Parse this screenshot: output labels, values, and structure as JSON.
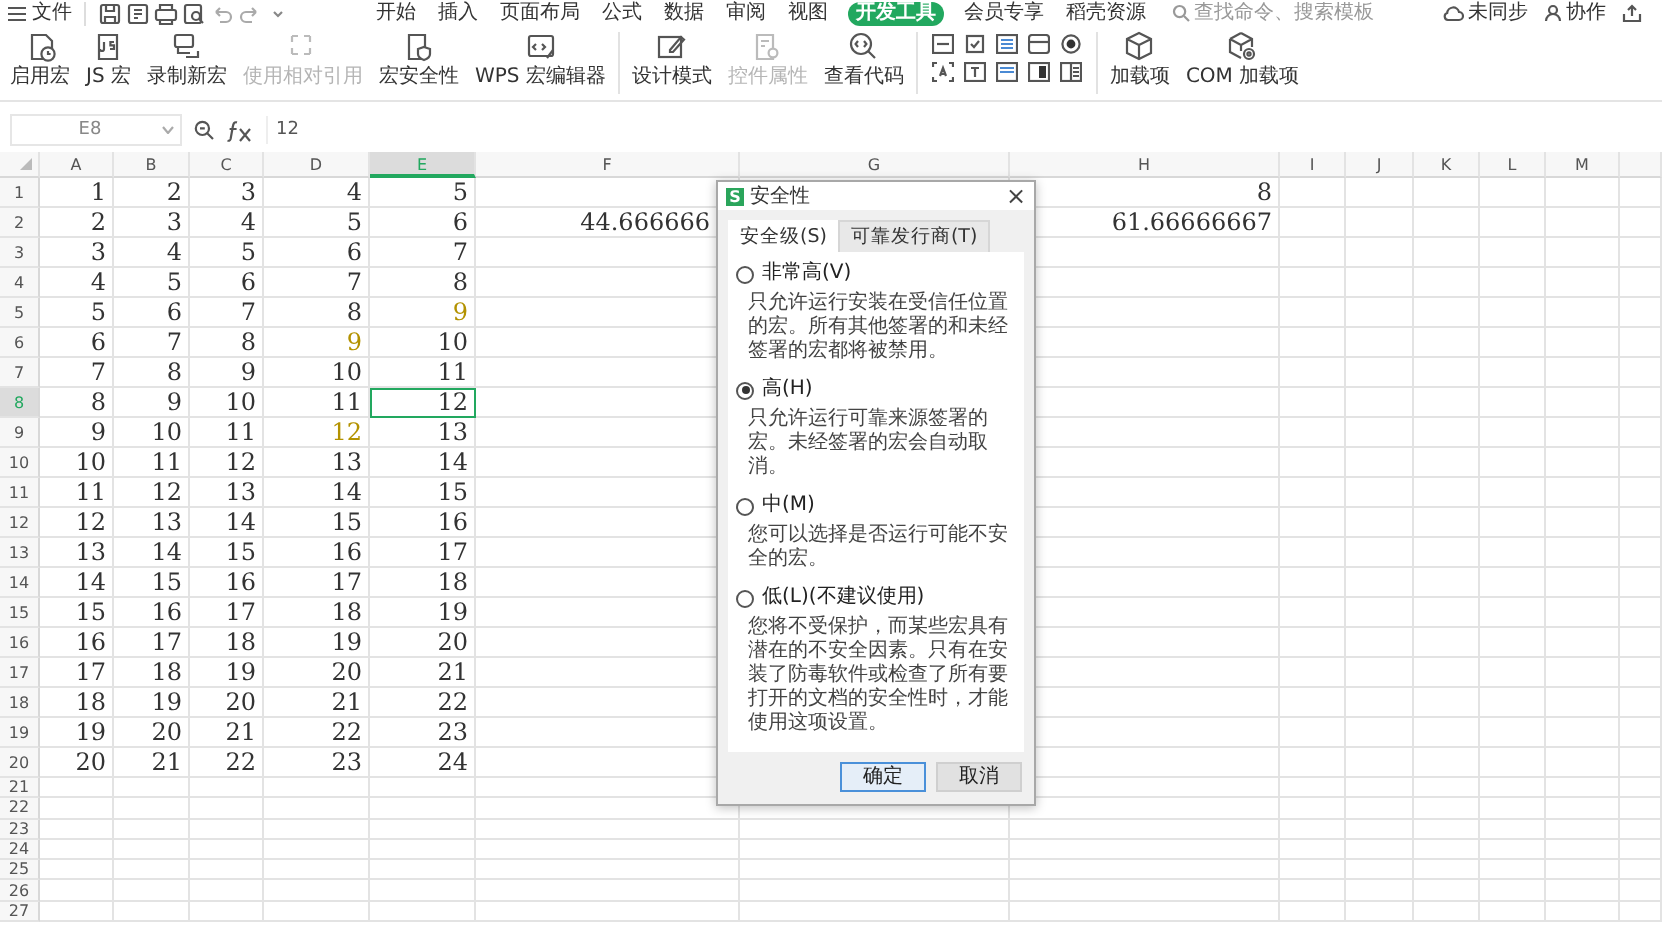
{
  "menu_bar": {
    "file_menu": "文件",
    "tabs": [
      {
        "label": "开始",
        "selected": false
      },
      {
        "label": "插入",
        "selected": false
      },
      {
        "label": "页面布局",
        "selected": false
      },
      {
        "label": "公式",
        "selected": false
      },
      {
        "label": "数据",
        "selected": false
      },
      {
        "label": "审阅",
        "selected": false
      },
      {
        "label": "视图",
        "selected": false
      },
      {
        "label": "开发工具",
        "selected": true
      },
      {
        "label": "会员专享",
        "selected": false
      },
      {
        "label": "稻壳资源",
        "selected": false
      }
    ],
    "search": {
      "placeholder": "查找命令、搜索模板"
    },
    "sync_status": "未同步",
    "collaborate": "协作"
  },
  "ribbon": {
    "groups": [
      {
        "kind": "buttons",
        "items": [
          {
            "label": "启用宏",
            "disabled": false
          },
          {
            "label": "JS 宏",
            "disabled": false
          },
          {
            "label": "录制新宏",
            "disabled": false
          },
          {
            "label": "使用相对引用",
            "disabled": true
          },
          {
            "label": "宏安全性",
            "disabled": false
          },
          {
            "label": "WPS 宏编辑器",
            "disabled": false
          }
        ]
      },
      {
        "kind": "buttons",
        "items": [
          {
            "label": "设计模式",
            "disabled": false
          },
          {
            "label": "控件属性",
            "disabled": true
          },
          {
            "label": "查看代码",
            "disabled": false
          }
        ]
      },
      {
        "kind": "control_grid"
      },
      {
        "kind": "buttons",
        "items": [
          {
            "label": "加载项",
            "disabled": false
          },
          {
            "label": "COM 加载项",
            "disabled": false
          }
        ]
      }
    ]
  },
  "formula_bar": {
    "cell_reference": "E8",
    "value": "12"
  },
  "sheet": {
    "columns": [
      {
        "label": "A",
        "selected": false
      },
      {
        "label": "B",
        "selected": false
      },
      {
        "label": "C",
        "selected": false
      },
      {
        "label": "D",
        "selected": false
      },
      {
        "label": "E",
        "selected": true
      },
      {
        "label": "F",
        "selected": false
      },
      {
        "label": "G",
        "selected": false
      },
      {
        "label": "H",
        "selected": false
      },
      {
        "label": "I",
        "selected": false
      },
      {
        "label": "J",
        "selected": false
      },
      {
        "label": "K",
        "selected": false
      },
      {
        "label": "L",
        "selected": false
      },
      {
        "label": "M",
        "selected": false
      }
    ],
    "rows": [
      {
        "label": "1",
        "selected": false,
        "cells": {
          "col_a": {
            "text": "1",
            "selected": false
          },
          "col_b": {
            "text": "2",
            "selected": false
          },
          "col_c": {
            "text": "3",
            "selected": false
          },
          "col_d": {
            "text": "4",
            "selected": false
          },
          "col_e": {
            "text": "5",
            "selected": false
          },
          "col_h": {
            "text": "8",
            "selected": false
          }
        }
      },
      {
        "label": "2",
        "selected": false,
        "cells": {
          "col_a": {
            "text": "2",
            "selected": false
          },
          "col_b": {
            "text": "3",
            "selected": false
          },
          "col_c": {
            "text": "4",
            "selected": false
          },
          "col_d": {
            "text": "5",
            "selected": false
          },
          "col_e": {
            "text": "6",
            "selected": false
          },
          "col_f": {
            "text": "44.666666",
            "selected": false
          },
          "col_h": {
            "text": "61.66666667",
            "selected": false
          }
        }
      },
      {
        "label": "3",
        "selected": false,
        "cells": {
          "col_a": {
            "text": "3",
            "selected": false
          },
          "col_b": {
            "text": "4",
            "selected": false
          },
          "col_c": {
            "text": "5",
            "selected": false
          },
          "col_d": {
            "text": "6",
            "selected": false
          },
          "col_e": {
            "text": "7",
            "selected": false
          }
        }
      },
      {
        "label": "4",
        "selected": false,
        "cells": {
          "col_a": {
            "text": "4",
            "selected": false
          },
          "col_b": {
            "text": "5",
            "selected": false
          },
          "col_c": {
            "text": "6",
            "selected": false
          },
          "col_d": {
            "text": "7",
            "selected": false
          },
          "col_e": {
            "text": "8",
            "selected": false
          }
        }
      },
      {
        "label": "5",
        "selected": false,
        "cells": {
          "col_a": {
            "text": "5",
            "selected": false
          },
          "col_b": {
            "text": "6",
            "selected": false
          },
          "col_c": {
            "text": "7",
            "selected": false
          },
          "col_d": {
            "text": "8",
            "selected": false
          },
          "col_e": {
            "text": "9",
            "selected": false,
            "color": "#b39200"
          }
        }
      },
      {
        "label": "6",
        "selected": false,
        "cells": {
          "col_a": {
            "text": "6",
            "selected": false
          },
          "col_b": {
            "text": "7",
            "selected": false
          },
          "col_c": {
            "text": "8",
            "selected": false
          },
          "col_d": {
            "text": "9",
            "selected": false,
            "color": "#b39200"
          },
          "col_e": {
            "text": "10",
            "selected": false
          }
        }
      },
      {
        "label": "7",
        "selected": false,
        "cells": {
          "col_a": {
            "text": "7",
            "selected": false
          },
          "col_b": {
            "text": "8",
            "selected": false
          },
          "col_c": {
            "text": "9",
            "selected": false
          },
          "col_d": {
            "text": "10",
            "selected": false
          },
          "col_e": {
            "text": "11",
            "selected": false
          }
        }
      },
      {
        "label": "8",
        "selected": true,
        "cells": {
          "col_a": {
            "text": "8",
            "selected": false
          },
          "col_b": {
            "text": "9",
            "selected": false
          },
          "col_c": {
            "text": "10",
            "selected": false
          },
          "col_d": {
            "text": "11",
            "selected": false
          },
          "col_e": {
            "text": "12",
            "selected": true
          }
        }
      },
      {
        "label": "9",
        "selected": false,
        "cells": {
          "col_a": {
            "text": "9",
            "selected": false
          },
          "col_b": {
            "text": "10",
            "selected": false
          },
          "col_c": {
            "text": "11",
            "selected": false
          },
          "col_d": {
            "text": "12",
            "selected": false,
            "color": "#b39200"
          },
          "col_e": {
            "text": "13",
            "selected": false
          }
        }
      },
      {
        "label": "10",
        "selected": false,
        "cells": {
          "col_a": {
            "text": "10",
            "selected": false
          },
          "col_b": {
            "text": "11",
            "selected": false
          },
          "col_c": {
            "text": "12",
            "selected": false
          },
          "col_d": {
            "text": "13",
            "selected": false
          },
          "col_e": {
            "text": "14",
            "selected": false
          }
        }
      },
      {
        "label": "11",
        "selected": false,
        "cells": {
          "col_a": {
            "text": "11",
            "selected": false
          },
          "col_b": {
            "text": "12",
            "selected": false
          },
          "col_c": {
            "text": "13",
            "selected": false
          },
          "col_d": {
            "text": "14",
            "selected": false
          },
          "col_e": {
            "text": "15",
            "selected": false
          }
        }
      },
      {
        "label": "12",
        "selected": false,
        "cells": {
          "col_a": {
            "text": "12",
            "selected": false
          },
          "col_b": {
            "text": "13",
            "selected": false
          },
          "col_c": {
            "text": "14",
            "selected": false
          },
          "col_d": {
            "text": "15",
            "selected": false
          },
          "col_e": {
            "text": "16",
            "selected": false
          }
        }
      },
      {
        "label": "13",
        "selected": false,
        "cells": {
          "col_a": {
            "text": "13",
            "selected": false
          },
          "col_b": {
            "text": "14",
            "selected": false
          },
          "col_c": {
            "text": "15",
            "selected": false
          },
          "col_d": {
            "text": "16",
            "selected": false
          },
          "col_e": {
            "text": "17",
            "selected": false
          }
        }
      },
      {
        "label": "14",
        "selected": false,
        "cells": {
          "col_a": {
            "text": "14",
            "selected": false
          },
          "col_b": {
            "text": "15",
            "selected": false
          },
          "col_c": {
            "text": "16",
            "selected": false
          },
          "col_d": {
            "text": "17",
            "selected": false
          },
          "col_e": {
            "text": "18",
            "selected": false
          }
        }
      },
      {
        "label": "15",
        "selected": false,
        "cells": {
          "col_a": {
            "text": "15",
            "selected": false
          },
          "col_b": {
            "text": "16",
            "selected": false
          },
          "col_c": {
            "text": "17",
            "selected": false
          },
          "col_d": {
            "text": "18",
            "selected": false
          },
          "col_e": {
            "text": "19",
            "selected": false
          }
        }
      },
      {
        "label": "16",
        "selected": false,
        "cells": {
          "col_a": {
            "text": "16",
            "selected": false
          },
          "col_b": {
            "text": "17",
            "selected": false
          },
          "col_c": {
            "text": "18",
            "selected": false
          },
          "col_d": {
            "text": "19",
            "selected": false
          },
          "col_e": {
            "text": "20",
            "selected": false
          }
        }
      },
      {
        "label": "17",
        "selected": false,
        "cells": {
          "col_a": {
            "text": "17",
            "selected": false
          },
          "col_b": {
            "text": "18",
            "selected": false
          },
          "col_c": {
            "text": "19",
            "selected": false
          },
          "col_d": {
            "text": "20",
            "selected": false
          },
          "col_e": {
            "text": "21",
            "selected": false
          }
        }
      },
      {
        "label": "18",
        "selected": false,
        "cells": {
          "col_a": {
            "text": "18",
            "selected": false
          },
          "col_b": {
            "text": "19",
            "selected": false
          },
          "col_c": {
            "text": "20",
            "selected": false
          },
          "col_d": {
            "text": "21",
            "selected": false
          },
          "col_e": {
            "text": "22",
            "selected": false
          }
        }
      },
      {
        "label": "19",
        "selected": false,
        "cells": {
          "col_a": {
            "text": "19",
            "selected": false
          },
          "col_b": {
            "text": "20",
            "selected": false
          },
          "col_c": {
            "text": "21",
            "selected": false
          },
          "col_d": {
            "text": "22",
            "selected": false
          },
          "col_e": {
            "text": "23",
            "selected": false
          }
        }
      },
      {
        "label": "20",
        "selected": false,
        "cells": {
          "col_a": {
            "text": "20",
            "selected": false
          },
          "col_b": {
            "text": "21",
            "selected": false
          },
          "col_c": {
            "text": "22",
            "selected": false
          },
          "col_d": {
            "text": "23",
            "selected": false
          },
          "col_e": {
            "text": "24",
            "selected": false
          }
        }
      },
      {
        "label": "21",
        "selected": false
      },
      {
        "label": "22",
        "selected": false
      },
      {
        "label": "23",
        "selected": false
      },
      {
        "label": "24",
        "selected": false
      },
      {
        "label": "25",
        "selected": false
      },
      {
        "label": "26",
        "selected": false
      },
      {
        "label": "27",
        "selected": false
      }
    ]
  },
  "dialog": {
    "logo": "S",
    "title": "安全性",
    "close": "×",
    "tabs": [
      {
        "label": "安全级(S)",
        "selected": true
      },
      {
        "label": "可靠发行商(T)",
        "selected": false
      }
    ],
    "options": [
      {
        "label": "非常高(V)",
        "selected": false,
        "description": "只允许运行安装在受信任位置的宏。所有其他签署的和未经签署的宏都将被禁用。"
      },
      {
        "label": "高(H)",
        "selected": true,
        "description": "只允许运行可靠来源签署的宏。未经签署的宏会自动取消。"
      },
      {
        "label": "中(M)",
        "selected": false,
        "description": "您可以选择是否运行可能不安全的宏。"
      },
      {
        "label": "低(L)(不建议使用)",
        "selected": false,
        "description": "您将不受保护，而某些宏具有潜在的不安全因素。只有在安装了防毒软件或检查了所有要打开的文档的安全性时，才能使用这项设置。"
      }
    ],
    "buttons": [
      {
        "label": "确定",
        "default": true
      },
      {
        "label": "取消",
        "default": false
      }
    ]
  }
}
